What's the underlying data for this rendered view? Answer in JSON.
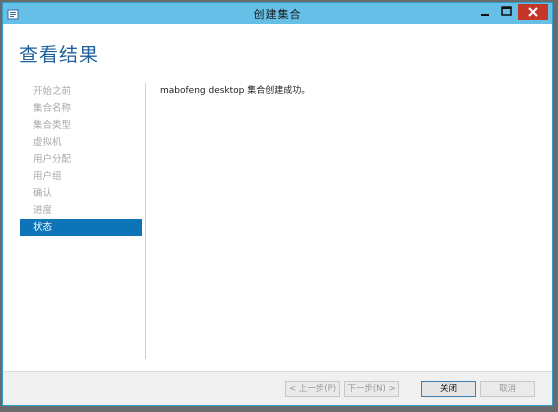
{
  "window": {
    "title": "创建集合"
  },
  "header": {
    "title": "查看结果"
  },
  "nav": {
    "items": [
      {
        "label": "开始之前"
      },
      {
        "label": "集合名称"
      },
      {
        "label": "集合类型"
      },
      {
        "label": "虚拟机"
      },
      {
        "label": "用户分配"
      },
      {
        "label": "用户组"
      },
      {
        "label": "确认"
      },
      {
        "label": "进度"
      },
      {
        "label": "状态"
      }
    ],
    "active_index": 8
  },
  "content": {
    "message": "mabofeng desktop 集合创建成功。"
  },
  "footer": {
    "prev_label": "< 上一步(P)",
    "next_label": "下一步(N) >",
    "close_label": "关闭",
    "cancel_label": "取消"
  },
  "colors": {
    "titlebar": "#66bfe6",
    "close_button": "#c4352a",
    "accent": "#0d74b8",
    "page_title": "#1f5f9a"
  }
}
